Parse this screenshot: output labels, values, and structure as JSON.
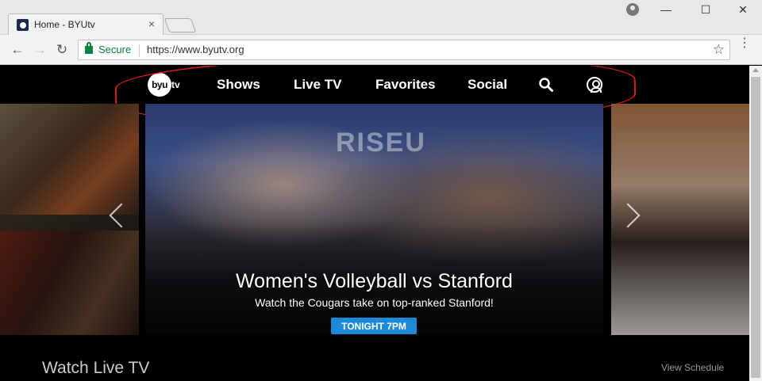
{
  "browser": {
    "tab_title": "Home - BYUtv",
    "tab_close": "×",
    "window_controls": {
      "minimize": "—",
      "maximize": "☐",
      "close": "✕"
    },
    "nav": {
      "back": "←",
      "forward": "→",
      "reload": "↻"
    },
    "secure_label": "Secure",
    "url": "https://www.byutv.org",
    "bookmark": "☆",
    "menu": "⋮"
  },
  "site": {
    "logo": {
      "text": "byu",
      "suffix": "tv"
    },
    "nav_links": [
      "Shows",
      "Live TV",
      "Favorites",
      "Social"
    ],
    "icons": [
      "search-icon",
      "account-icon"
    ],
    "annotation_color": "#d81b1b"
  },
  "carousel": {
    "hero": {
      "banner": "RISEU",
      "title": "Women's Volleyball vs Stanford",
      "subtitle": "Watch the Cougars take on top-ranked Stanford!",
      "badge": "TONIGHT 7PM",
      "badge_color": "#1c8ad8"
    }
  },
  "sections": {
    "live": {
      "title": "Watch Live TV",
      "link": "View Schedule"
    }
  }
}
